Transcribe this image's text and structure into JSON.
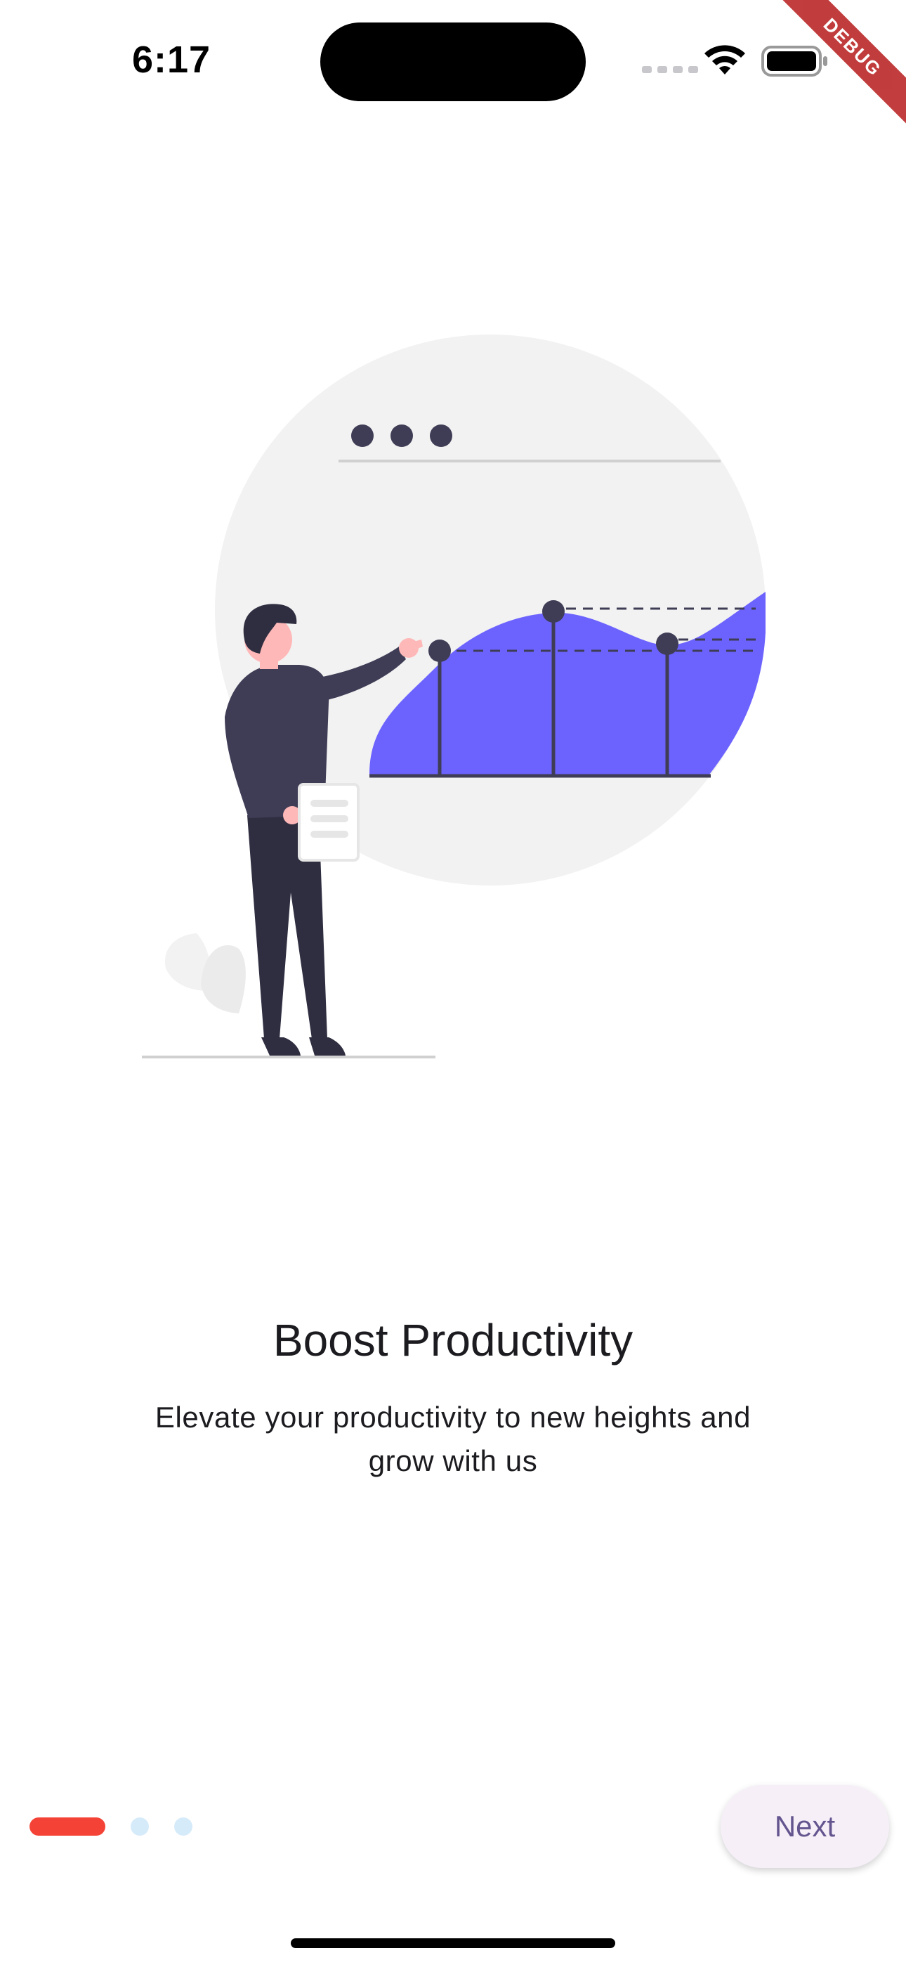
{
  "status_bar": {
    "time": "6:17",
    "icons": [
      "signal-dots-icon",
      "wifi-icon",
      "battery-icon"
    ]
  },
  "debug_banner": {
    "label": "DEBUG",
    "color": "#b71c1c"
  },
  "onboarding": {
    "illustration": "person-presenting-chart-illustration",
    "title": "Boost Productivity",
    "subtitle": "Elevate your productivity to new heights and grow with us",
    "page_indicator": {
      "total_pages": 3,
      "current_page": 1,
      "active_color": "#f44336",
      "inactive_color": "#d6ebfa"
    },
    "next_button": {
      "label": "Next"
    }
  },
  "colors": {
    "accent_chart": "#6c63ff",
    "figure_dark": "#3f3d56",
    "circle_bg": "#f2f2f2",
    "button_text": "#65558f",
    "button_bg": "#f6eff8"
  }
}
